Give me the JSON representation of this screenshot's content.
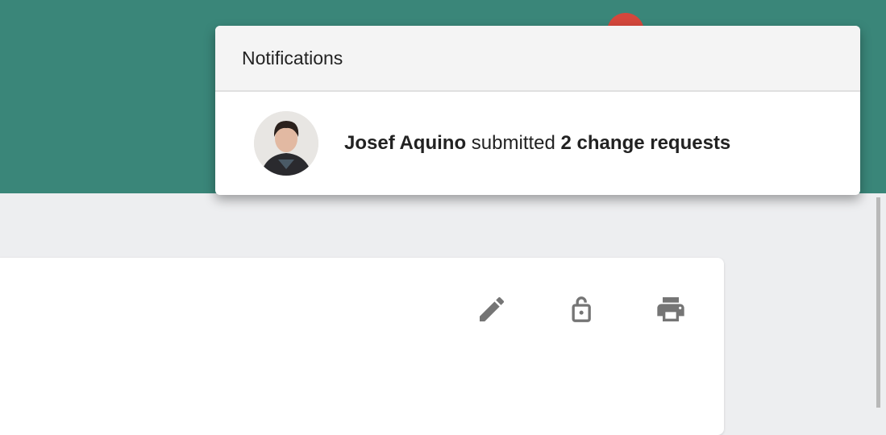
{
  "notifications": {
    "title": "Notifications",
    "items": [
      {
        "actor": "Josef Aquino",
        "action": "submitted",
        "object": "2 change requests"
      }
    ]
  },
  "toolbar": {
    "icons": [
      "pencil-icon",
      "lock-open-icon",
      "printer-icon"
    ]
  },
  "colors": {
    "header": "#3a8679",
    "badge": "#d4473c",
    "icon": "#757575"
  }
}
